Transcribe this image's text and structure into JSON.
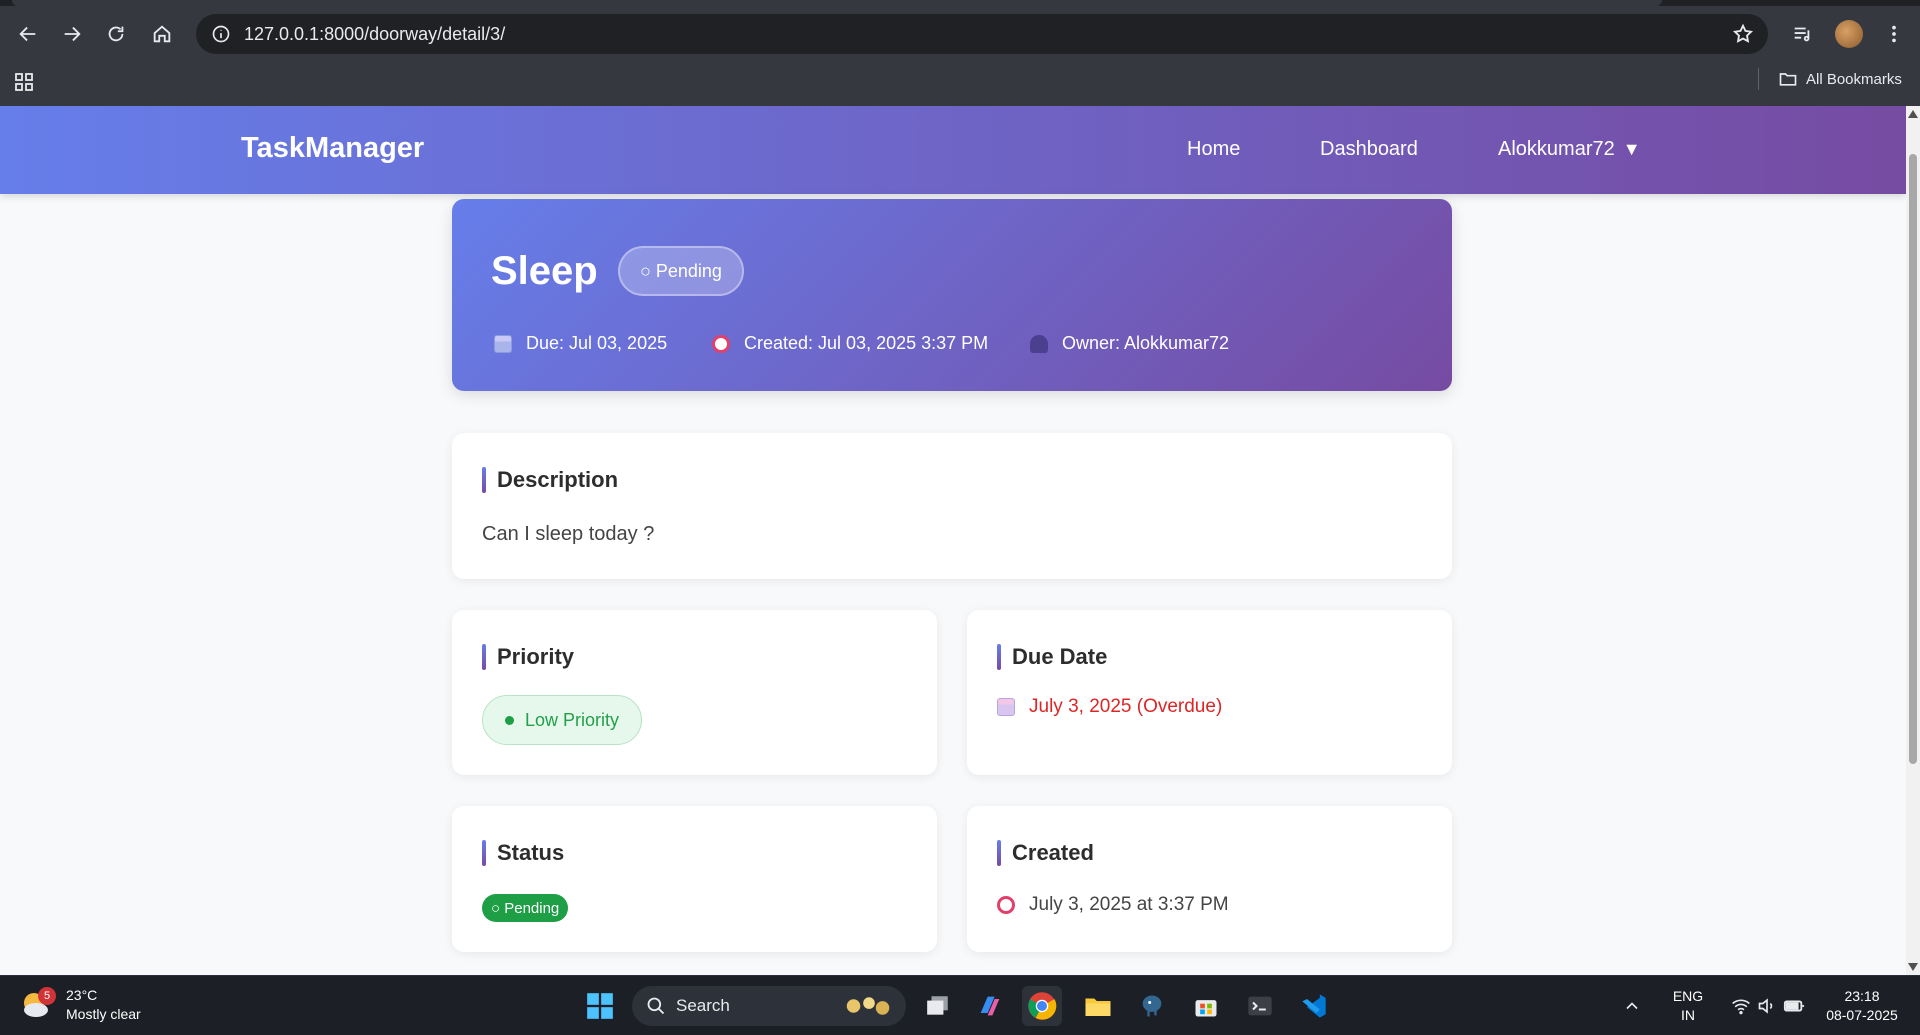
{
  "browser": {
    "url": "127.0.0.1:8000/doorway/detail/3/",
    "bookmarks_label": "All Bookmarks"
  },
  "navbar": {
    "brand": "TaskManager",
    "links": [
      "Home",
      "Dashboard"
    ],
    "user": "Alokkumar72",
    "user_caret": "▼"
  },
  "task": {
    "title": "Sleep",
    "status_pill": "○ Pending",
    "meta_due": "Due: Jul 03, 2025",
    "meta_created": "Created: Jul 03, 2025 3:37 PM",
    "meta_owner": "Owner: Alokkumar72"
  },
  "description": {
    "heading": "Description",
    "text": "Can I sleep today ?"
  },
  "priority": {
    "heading": "Priority",
    "badge": "Low Priority"
  },
  "due_date": {
    "heading": "Due Date",
    "value": "July 3, 2025 (Overdue)"
  },
  "status": {
    "heading": "Status",
    "badge": "○ Pending"
  },
  "created": {
    "heading": "Created",
    "value": "July 3, 2025 at 3:37 PM"
  },
  "taskbar": {
    "weather_badge": "5",
    "weather_temp": "23°C",
    "weather_desc": "Mostly clear",
    "search_label": "Search",
    "lang_1": "ENG",
    "lang_2": "IN",
    "time": "23:18",
    "date": "08-07-2025"
  },
  "colors": {
    "gradient_start": "#667eea",
    "gradient_end": "#764ba2",
    "overdue": "#dc2626",
    "success": "#1e9e45"
  }
}
